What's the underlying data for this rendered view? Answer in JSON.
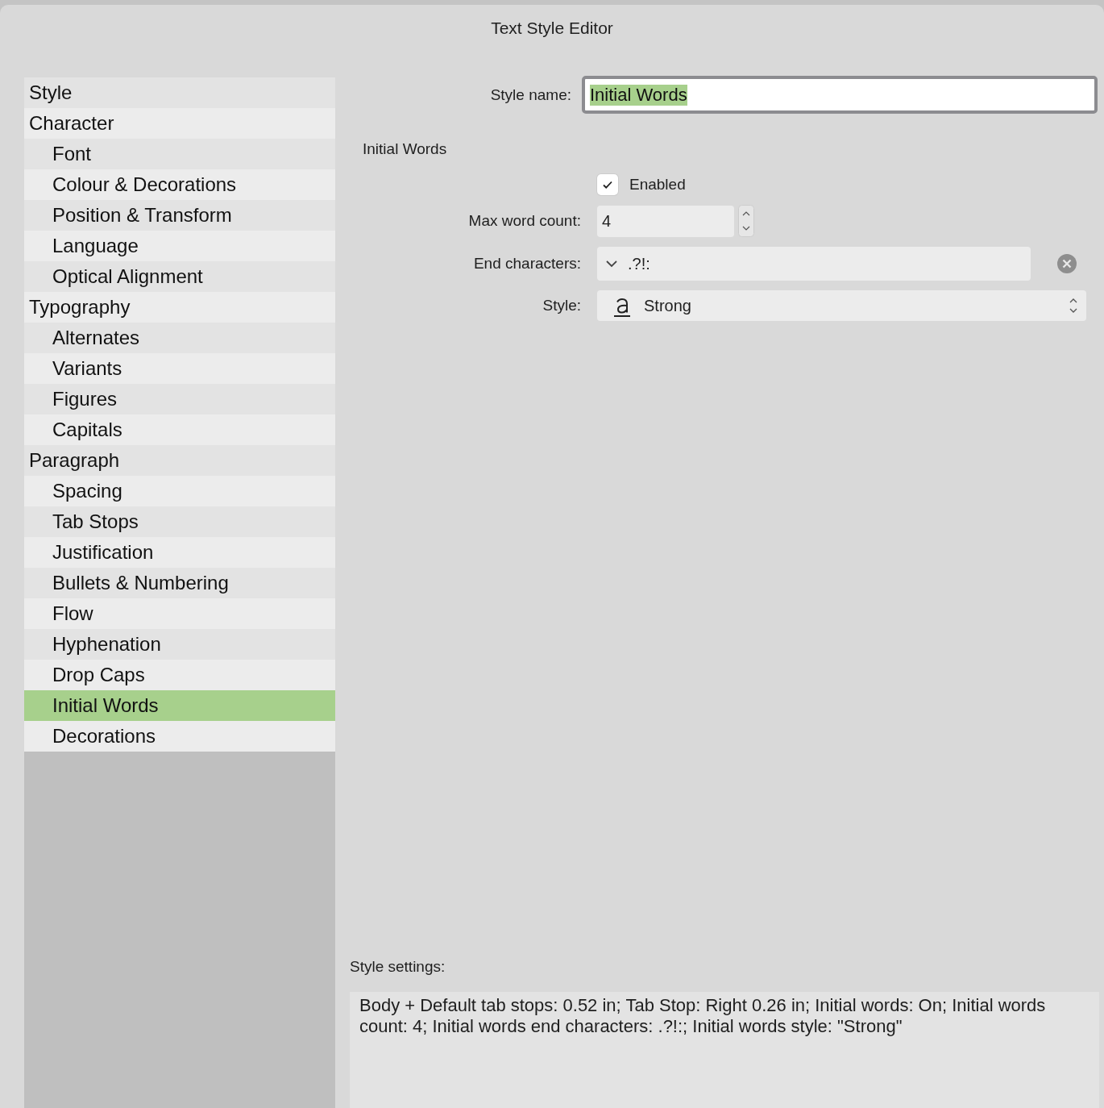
{
  "window": {
    "title": "Text Style Editor"
  },
  "sidebar": {
    "items": [
      {
        "label": "Style",
        "selected": false
      },
      {
        "label": "Character",
        "selected": false,
        "children": [
          {
            "label": "Font",
            "selected": false
          },
          {
            "label": "Colour & Decorations",
            "selected": false
          },
          {
            "label": "Position & Transform",
            "selected": false
          },
          {
            "label": "Language",
            "selected": false
          },
          {
            "label": "Optical Alignment",
            "selected": false
          }
        ]
      },
      {
        "label": "Typography",
        "selected": false,
        "children": [
          {
            "label": "Alternates",
            "selected": false
          },
          {
            "label": "Variants",
            "selected": false
          },
          {
            "label": "Figures",
            "selected": false
          },
          {
            "label": "Capitals",
            "selected": false
          }
        ]
      },
      {
        "label": "Paragraph",
        "selected": false,
        "children": [
          {
            "label": "Spacing",
            "selected": false
          },
          {
            "label": "Tab Stops",
            "selected": false
          },
          {
            "label": "Justification",
            "selected": false
          },
          {
            "label": "Bullets & Numbering",
            "selected": false
          },
          {
            "label": "Flow",
            "selected": false
          },
          {
            "label": "Hyphenation",
            "selected": false
          },
          {
            "label": "Drop Caps",
            "selected": false
          },
          {
            "label": "Initial Words",
            "selected": true
          },
          {
            "label": "Decorations",
            "selected": false
          }
        ]
      }
    ]
  },
  "style_name": {
    "label": "Style name:",
    "value": "Initial Words",
    "text_selected": true
  },
  "section": {
    "title": "Initial Words",
    "enabled": {
      "label": "Enabled",
      "checked": true
    },
    "max_word_count": {
      "label": "Max word count:",
      "value": "4"
    },
    "end_characters": {
      "label": "End characters:",
      "value": ".?!:"
    },
    "style": {
      "label": "Style:",
      "value": "Strong"
    }
  },
  "style_settings": {
    "label": "Style settings:",
    "text": "Body + Default tab stops: 0.52 in; Tab Stop: Right 0.26 in; Initial words: On; Initial words count: 4; Initial words end characters: .?!:; Initial words style: \"Strong\""
  }
}
